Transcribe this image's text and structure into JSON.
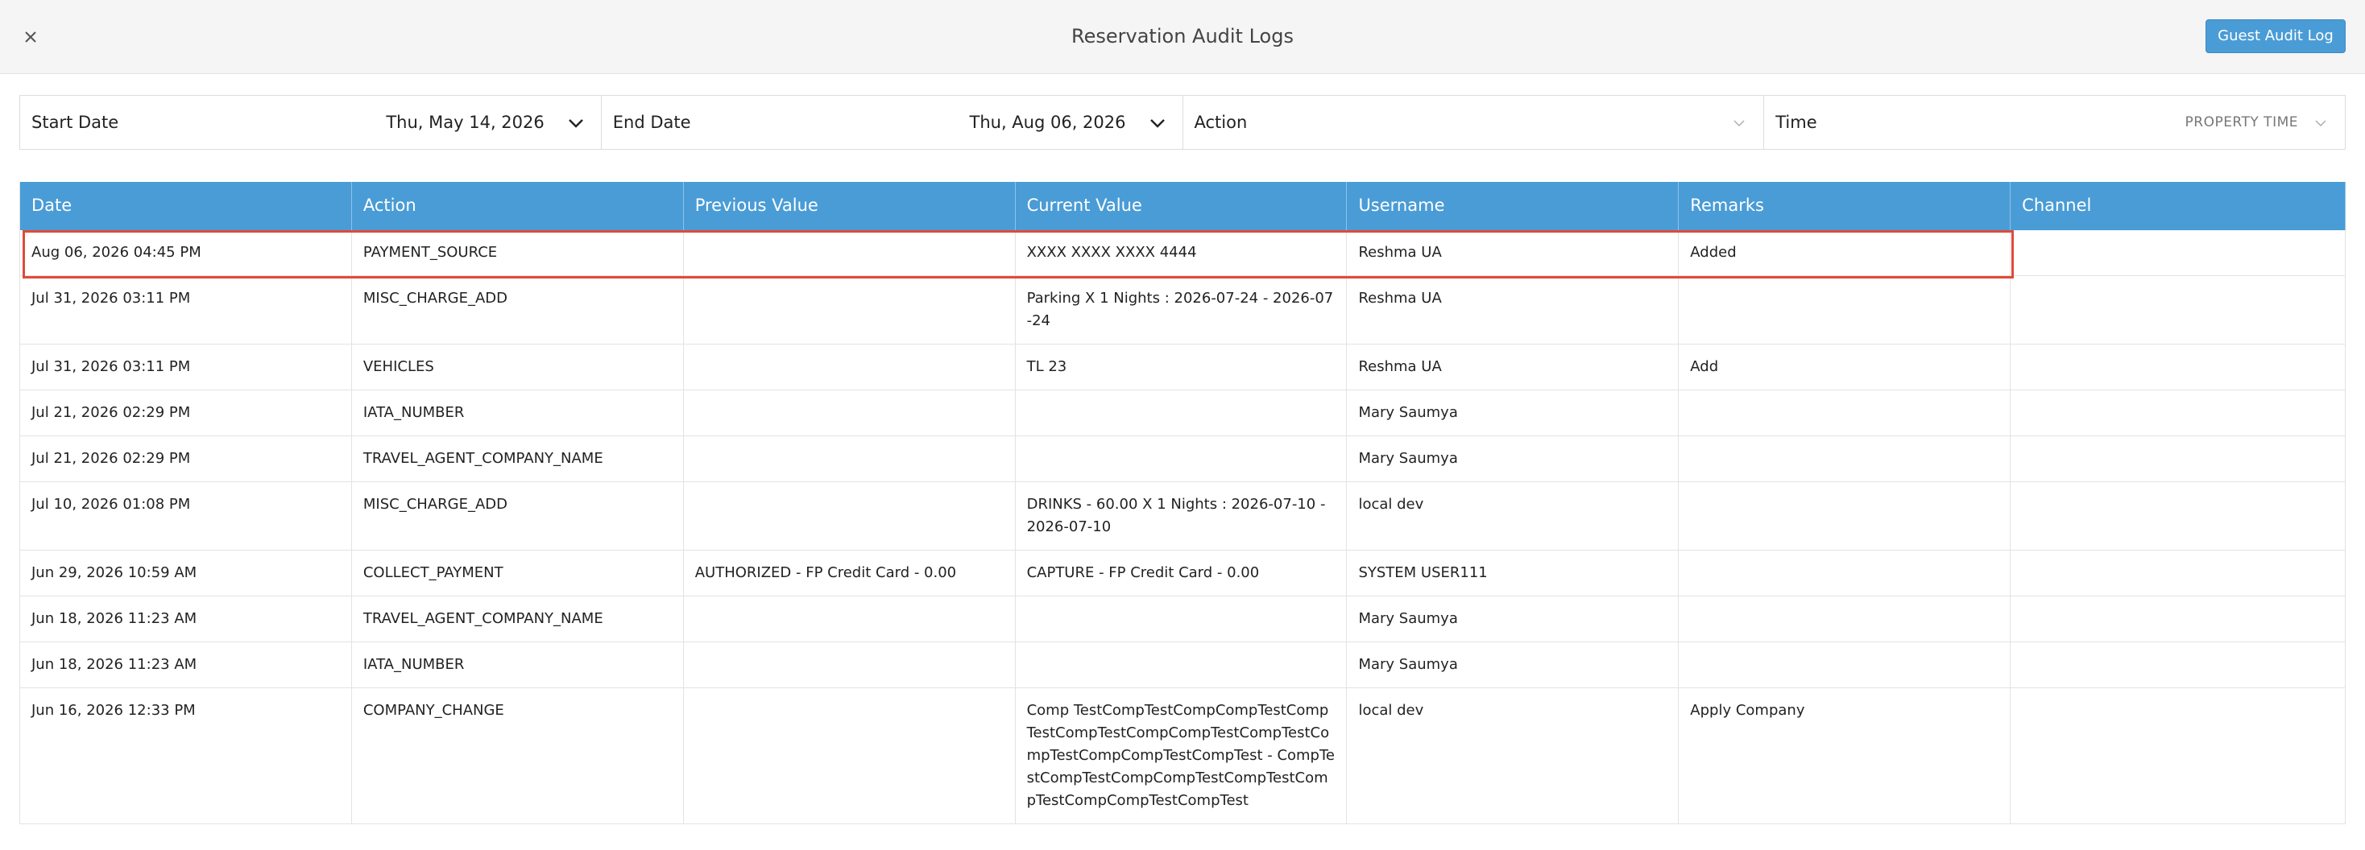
{
  "header": {
    "title": "Reservation Audit Logs",
    "guest_audit_label": "Guest Audit Log"
  },
  "filters": {
    "start_date": {
      "label": "Start Date",
      "value": "Thu, May 14, 2026"
    },
    "end_date": {
      "label": "End Date",
      "value": "Thu, Aug 06, 2026"
    },
    "action": {
      "label": "Action"
    },
    "time": {
      "label": "Time",
      "value": "PROPERTY TIME"
    }
  },
  "table": {
    "columns": [
      "Date",
      "Action",
      "Previous Value",
      "Current Value",
      "Username",
      "Remarks",
      "Channel"
    ],
    "rows": [
      [
        "Aug 06, 2026 04:45 PM",
        "PAYMENT_SOURCE",
        "",
        "XXXX XXXX XXXX 4444",
        "Reshma UA",
        "Added",
        ""
      ],
      [
        "Jul 31, 2026 03:11 PM",
        "MISC_CHARGE_ADD",
        "",
        "Parking X 1 Nights : 2026-07-24 - 2026-07-24",
        "Reshma UA",
        "",
        ""
      ],
      [
        "Jul 31, 2026 03:11 PM",
        "VEHICLES",
        "",
        "TL 23",
        "Reshma UA",
        "Add",
        ""
      ],
      [
        "Jul 21, 2026 02:29 PM",
        "IATA_NUMBER",
        "",
        "",
        "Mary Saumya",
        "",
        ""
      ],
      [
        "Jul 21, 2026 02:29 PM",
        "TRAVEL_AGENT_COMPANY_NAME",
        "",
        "",
        "Mary Saumya",
        "",
        ""
      ],
      [
        "Jul 10, 2026 01:08 PM",
        "MISC_CHARGE_ADD",
        "",
        "DRINKS - 60.00 X 1 Nights : 2026-07-10 - 2026-07-10",
        "local dev",
        "",
        ""
      ],
      [
        "Jun 29, 2026 10:59 AM",
        "COLLECT_PAYMENT",
        "AUTHORIZED - FP Credit Card - 0.00",
        "CAPTURE - FP Credit Card - 0.00",
        "SYSTEM USER111",
        "",
        ""
      ],
      [
        "Jun 18, 2026 11:23 AM",
        "TRAVEL_AGENT_COMPANY_NAME",
        "",
        "",
        "Mary Saumya",
        "",
        ""
      ],
      [
        "Jun 18, 2026 11:23 AM",
        "IATA_NUMBER",
        "",
        "",
        "Mary Saumya",
        "",
        ""
      ],
      [
        "Jun 16, 2026 12:33 PM",
        "COMPANY_CHANGE",
        "",
        "Comp TestCompTestCompCompTestCompTestCompTestCompCompTestCompTestCompTestCompCompTestCompTest - CompTestCompTestCompCompTestCompTestCompTestCompCompTestCompTest",
        "local dev",
        "Apply Company",
        ""
      ]
    ]
  },
  "colors": {
    "header_bg": "#4a9cd6",
    "highlight": "#e04a3a",
    "button_bg": "#4a9cd6"
  },
  "icons": {
    "close": "close-icon",
    "chevron": "chevron-down-icon"
  }
}
